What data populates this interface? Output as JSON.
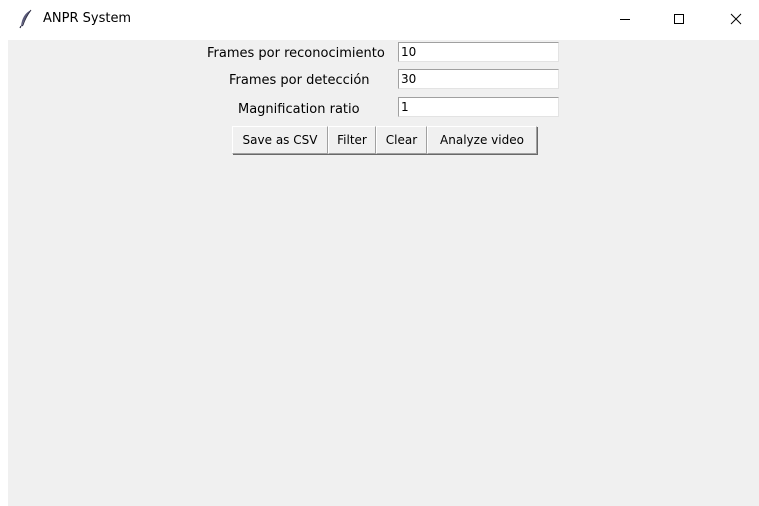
{
  "window": {
    "title": "ANPR System",
    "app_icon": "tk-feather-icon",
    "controls": {
      "minimize_icon": "minimize-icon",
      "maximize_icon": "maximize-icon",
      "close_icon": "close-icon"
    }
  },
  "form": {
    "fields": [
      {
        "label": "Frames por reconocimiento",
        "value": "10"
      },
      {
        "label": "Frames por detección",
        "value": "30"
      },
      {
        "label": "Magnification ratio",
        "value": "1"
      }
    ]
  },
  "buttons": {
    "save_csv": "Save as CSV",
    "filter": "Filter",
    "clear": "Clear",
    "analyze_video": "Analyze video"
  },
  "colors": {
    "client_background": "#f0f0f0",
    "titlebar_background": "#ffffff",
    "entry_background": "#ffffff"
  }
}
